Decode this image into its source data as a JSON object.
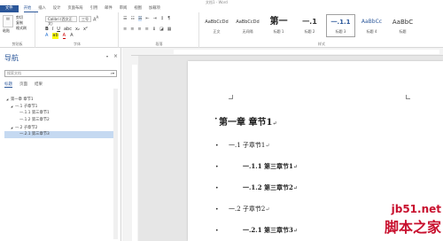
{
  "titlebar": {
    "text": "文档1 - Word"
  },
  "menu": [
    "文件",
    "开始",
    "插入",
    "设计",
    "页面布局",
    "引用",
    "邮件",
    "审阅",
    "视图",
    "加载项"
  ],
  "ribbon": {
    "clipboard": {
      "paste": "粘贴",
      "cut": "剪切",
      "copy": "复制",
      "format_painter": "格式刷",
      "label": "剪贴板"
    },
    "font": {
      "font_name": "Calibri (西文正文)",
      "font_size": "三号",
      "label": "字体"
    },
    "paragraph": {
      "label": "段落"
    },
    "styles": {
      "label": "样式",
      "items": [
        {
          "preview": "AaBbCcDd",
          "name": "正文"
        },
        {
          "preview": "AaBbCcDd",
          "name": "无间隔"
        },
        {
          "preview": "第一",
          "name": "标题 1"
        },
        {
          "preview": "一.1",
          "name": "标题 2"
        },
        {
          "preview": "一.1.1",
          "name": "标题 3"
        },
        {
          "preview": "AaBbCc",
          "name": "标题 4"
        },
        {
          "preview": "AaBbC",
          "name": "标题"
        }
      ]
    }
  },
  "nav": {
    "title": "导航",
    "search_placeholder": "搜索文档",
    "tabs": [
      "标题",
      "页面",
      "结果"
    ],
    "tree": [
      {
        "label": "第一章 章节1",
        "level": 0,
        "arrow": "◢",
        "selected": false
      },
      {
        "label": "一.1 子章节1",
        "level": 1,
        "arrow": "◢",
        "selected": false
      },
      {
        "label": "一.1.1 第三章节1",
        "level": 2,
        "arrow": "",
        "selected": false
      },
      {
        "label": "一.1.2 第三章节2",
        "level": 2,
        "arrow": "",
        "selected": false
      },
      {
        "label": "一.2 子章节2",
        "level": 1,
        "arrow": "◢",
        "selected": false
      },
      {
        "label": "一.2.1 第三章节3",
        "level": 2,
        "arrow": "",
        "selected": true
      }
    ]
  },
  "document": {
    "paragraphs": [
      {
        "text": "第一章  章节1",
        "style": "h1"
      },
      {
        "text": "一.1  子章节1",
        "style": "h2"
      },
      {
        "text": "一.1.1  第三章节1",
        "style": "h3"
      },
      {
        "text": "一.1.2  第三章节2",
        "style": "h3"
      },
      {
        "text": "一.2  子章节2",
        "style": "h2"
      },
      {
        "text": "一.2.1  第三章节3",
        "style": "h3"
      }
    ],
    "mark": "↵"
  },
  "watermark": {
    "line1": "jb51.net",
    "line2": "脚本之家"
  }
}
